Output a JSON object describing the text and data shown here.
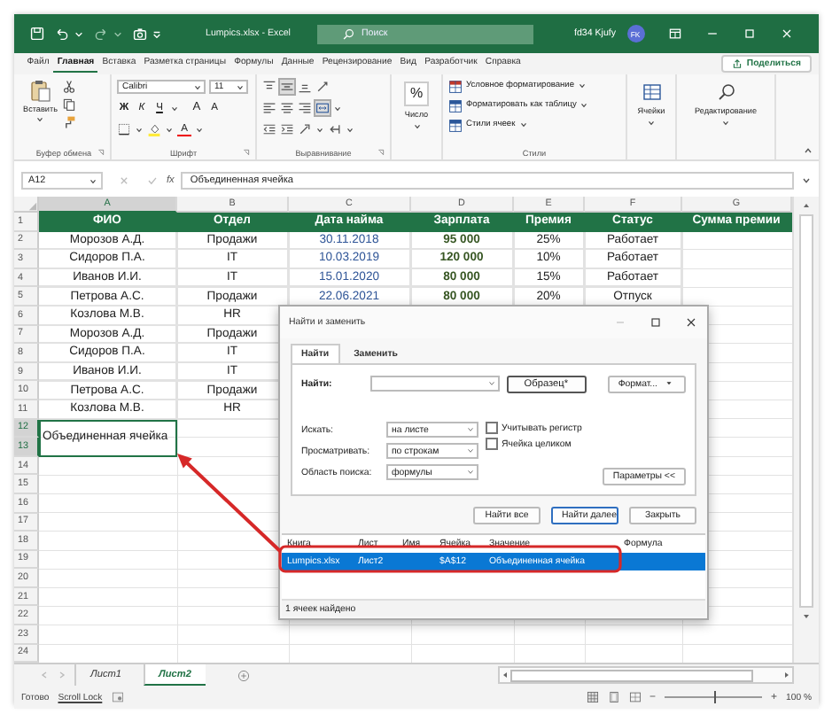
{
  "window": {
    "title": "Lumpics.xlsx - Excel",
    "search": {
      "placeholder": "Поиск"
    },
    "user": "fd34 Kjufy",
    "avatar": "FK"
  },
  "menu": [
    {
      "label": "Файл",
      "selected": false
    },
    {
      "label": "Главная",
      "selected": true
    },
    {
      "label": "Вставка",
      "selected": false
    },
    {
      "label": "Разметка страницы",
      "selected": false
    },
    {
      "label": "Формулы",
      "selected": false
    },
    {
      "label": "Данные",
      "selected": false
    },
    {
      "label": "Рецензирование",
      "selected": false
    },
    {
      "label": "Вид",
      "selected": false
    },
    {
      "label": "Разработчик",
      "selected": false
    },
    {
      "label": "Справка",
      "selected": false
    }
  ],
  "share_button": "Поделиться",
  "ribbon": {
    "clipboard": {
      "paste": "Вставить",
      "label": "Буфер обмена"
    },
    "font": {
      "name": "Calibri",
      "size": "11",
      "styles": [
        "Ж",
        "К",
        "Ч"
      ],
      "grow": "A",
      "shrink": "A",
      "color_button": "A",
      "label": "Шрифт"
    },
    "alignment": {
      "label": "Выравнивание"
    },
    "number": {
      "symbol": "%",
      "label": "Число"
    },
    "styles": {
      "items": [
        "Условное форматирование",
        "Форматировать как таблицу",
        "Стили ячеек"
      ],
      "label": "Стили"
    },
    "cells": {
      "label": "Ячейки"
    },
    "editing": {
      "label": "Редактирование"
    }
  },
  "formula_bar": {
    "name_box": "A12",
    "function_symbol": "fx",
    "value": "Объединенная ячейка"
  },
  "sheet": {
    "columns": [
      "A",
      "B",
      "C",
      "D",
      "E",
      "F",
      "G"
    ],
    "row_numbers": [
      "1",
      "2",
      "3",
      "4",
      "5",
      "6",
      "7",
      "8",
      "9",
      "10",
      "11",
      "12",
      "13",
      "14",
      "15",
      "16",
      "17",
      "18",
      "19",
      "20",
      "21",
      "22",
      "23",
      "24"
    ],
    "rows": [
      {
        "kind": "header",
        "cells": [
          "ФИО",
          "Отдел",
          "Дата найма",
          "Зарплата",
          "Премия",
          "Статус",
          "Сумма премии"
        ]
      },
      {
        "kind": "data",
        "cells": [
          "Морозов А.Д.",
          "Продажи",
          "30.11.2018",
          "95 000",
          "25%",
          "Работает"
        ]
      },
      {
        "kind": "data",
        "cells": [
          "Сидоров П.А.",
          "IT",
          "10.03.2019",
          "120 000",
          "10%",
          "Работает"
        ]
      },
      {
        "kind": "data",
        "cells": [
          "Иванов И.И.",
          "IT",
          "15.01.2020",
          "80 000",
          "15%",
          "Работает"
        ]
      },
      {
        "kind": "data",
        "cells": [
          "Петрова А.С.",
          "Продажи",
          "22.06.2021",
          "80 000",
          "20%",
          "Отпуск"
        ]
      },
      {
        "kind": "data",
        "cells": [
          "Козлова М.В.",
          "HR"
        ]
      },
      {
        "kind": "data",
        "cells": [
          "Морозов А.Д.",
          "Продажи"
        ]
      },
      {
        "kind": "data",
        "cells": [
          "Сидоров П.А.",
          "IT"
        ]
      },
      {
        "kind": "data",
        "cells": [
          "Иванов И.И.",
          "IT"
        ]
      },
      {
        "kind": "data",
        "cells": [
          "Петрова А.С.",
          "Продажи"
        ]
      },
      {
        "kind": "data",
        "cells": [
          "Козлова М.В.",
          "HR"
        ]
      }
    ],
    "merged": {
      "text": "Объединенная ячейка",
      "selected": true
    }
  },
  "dialog": {
    "title": "Найти и заменить",
    "tabs": [
      {
        "label": "Найти",
        "selected": true
      },
      {
        "label": "Заменить",
        "selected": false
      }
    ],
    "find_label": "Найти:",
    "preview_button": "Образец*",
    "format_button": "Формат...",
    "options": [
      {
        "label": "Искать:",
        "value": "на листе"
      },
      {
        "label": "Просматривать:",
        "value": "по строкам"
      },
      {
        "label": "Область поиска:",
        "value": "формулы"
      }
    ],
    "checkboxes": [
      {
        "label": "Учитывать регистр",
        "checked": false
      },
      {
        "label": "Ячейка целиком",
        "checked": false
      }
    ],
    "options_button": "Параметры <<",
    "buttons": [
      {
        "label": "Найти все",
        "default": false
      },
      {
        "label": "Найти далее",
        "default": true
      },
      {
        "label": "Закрыть",
        "default": false
      }
    ],
    "results": {
      "columns": [
        "Книга",
        "Лист",
        "Имя",
        "Ячейка",
        "Значение",
        "Формула"
      ],
      "rows": [
        {
          "book": "Lumpics.xlsx",
          "sheet": "Лист2",
          "cell": "$A$12",
          "value": "Объединенная ячейка",
          "selected": true
        }
      ]
    },
    "status": "1 ячеек найдено"
  },
  "sheet_tabs": [
    {
      "label": "Лист1",
      "selected": false
    },
    {
      "label": "Лист2",
      "selected": true
    }
  ],
  "status_bar": {
    "items": [
      "Готово",
      "Scroll Lock"
    ],
    "zoom": {
      "out": "−",
      "in": "+",
      "level": 0.5,
      "reading": "100 %"
    }
  }
}
